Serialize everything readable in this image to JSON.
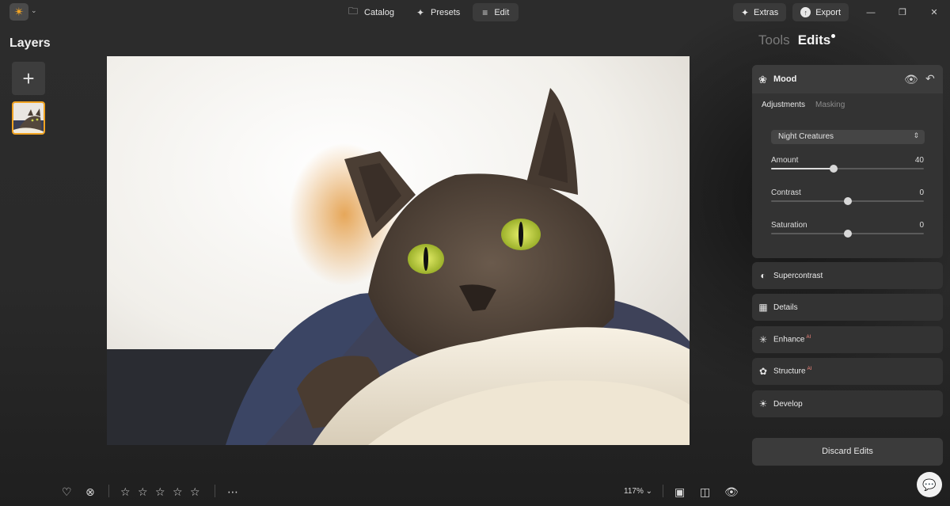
{
  "topbar": {
    "modes": [
      {
        "label": "Catalog",
        "icon": "folder-icon"
      },
      {
        "label": "Presets",
        "icon": "sparkle-icon"
      },
      {
        "label": "Edit",
        "icon": "sliders-icon",
        "active": true
      }
    ],
    "extras_label": "Extras",
    "export_label": "Export"
  },
  "layers": {
    "title": "Layers",
    "add_icon": "plus-icon"
  },
  "panel": {
    "tabs": [
      {
        "label": "Tools",
        "active": false
      },
      {
        "label": "Edits",
        "active": true
      }
    ],
    "mood": {
      "title": "Mood",
      "subtabs": [
        {
          "label": "Adjustments",
          "active": true
        },
        {
          "label": "Masking",
          "active": false
        }
      ],
      "preset": "Night Creatures",
      "sliders": [
        {
          "label": "Amount",
          "value": "40",
          "fraction": 0.41
        },
        {
          "label": "Contrast",
          "value": "0",
          "fraction": 0.5
        },
        {
          "label": "Saturation",
          "value": "0",
          "fraction": 0.5
        }
      ]
    },
    "sections": [
      {
        "label": "Supercontrast",
        "icon": "half-circle-icon",
        "ai": ""
      },
      {
        "label": "Details",
        "icon": "grid-icon",
        "ai": ""
      },
      {
        "label": "Enhance",
        "icon": "enhance-sparkle-icon",
        "ai": "AI"
      },
      {
        "label": "Structure",
        "icon": "structure-icon",
        "ai": "AI"
      },
      {
        "label": "Develop",
        "icon": "sun-icon",
        "ai": ""
      }
    ],
    "discard_label": "Discard Edits"
  },
  "bottombar": {
    "zoom": "117%",
    "rating_stars": 0,
    "rating_max": 5
  },
  "colors": {
    "accent": "#f0a321",
    "background": "#2a2a2a",
    "panel": "#333333"
  }
}
